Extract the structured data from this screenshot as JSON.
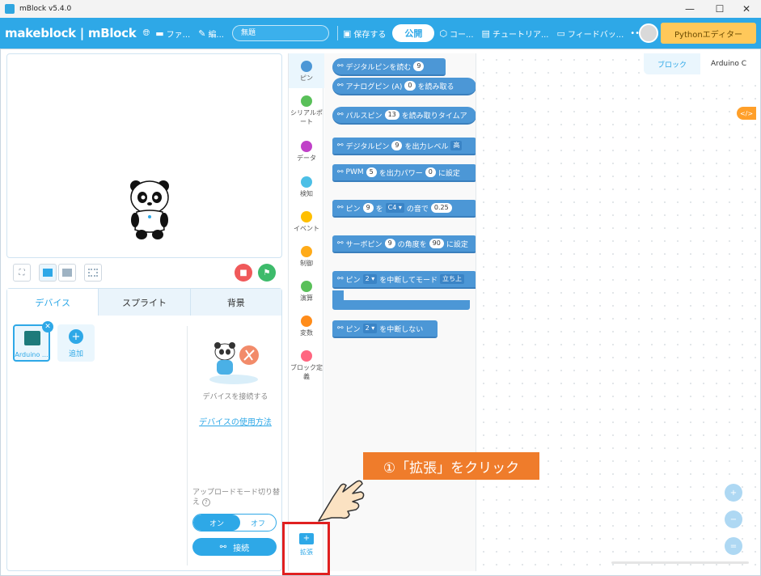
{
  "window": {
    "title": "mBlock v5.4.0",
    "minimize": "—",
    "maximize": "☐",
    "close": "✕"
  },
  "menubar": {
    "brand": "makeblock | mBlock",
    "file": "ファ...",
    "edit": "編...",
    "project_title": "無題",
    "save": "保存する",
    "publish": "公開",
    "course": "コー...",
    "tutorial": "チュートリア...",
    "feedback": "フィードバッ...",
    "more": "•••",
    "python_editor": "Pythonエディター",
    "icons": {
      "globe": "globe-icon",
      "folder": "folder-icon",
      "wrench": "wrench-icon",
      "save": "save-icon",
      "course": "course-icon",
      "tutorial": "book-icon",
      "feedback": "feedback-icon"
    }
  },
  "stage": {
    "sprite": "panda",
    "tools": {
      "fullscreen": "⛶",
      "stop": "■",
      "go": "⚑"
    }
  },
  "device_panel": {
    "tabs": [
      "デバイス",
      "スプライト",
      "背景"
    ],
    "active_tab": 0,
    "device_label": "Arduino ...",
    "add_label": "追加",
    "connect_prompt": "デバイスを接続する",
    "howto_link": "デバイスの使用方法",
    "upload_mode_label": "アップロードモード切り替え",
    "toggle_on": "オン",
    "toggle_off": "オフ",
    "connect_button": "接続"
  },
  "categories": [
    {
      "label": "ピン",
      "color": "#4c97d6"
    },
    {
      "label": "シリアルポート",
      "color": "#59c059"
    },
    {
      "label": "データ",
      "color": "#c040c8"
    },
    {
      "label": "検知",
      "color": "#4cbfe6"
    },
    {
      "label": "イベント",
      "color": "#ffbf00"
    },
    {
      "label": "制御",
      "color": "#ffab19"
    },
    {
      "label": "演算",
      "color": "#59c059"
    },
    {
      "label": "変数",
      "color": "#ff8c1a"
    },
    {
      "label": "ブロック定義",
      "color": "#ff6680"
    }
  ],
  "extension": {
    "label": "拡張",
    "icon": "+"
  },
  "blocks": {
    "b1": {
      "pre": "デジタルピンを読む",
      "v1": "9"
    },
    "b2": {
      "pre": "アナログピン (A)",
      "v1": "0",
      "post": "を読み取る"
    },
    "b3": {
      "pre": "パルスピン",
      "v1": "13",
      "post": "を読み取りタイムア"
    },
    "b4": {
      "pre": "デジタルピン",
      "v1": "9",
      "mid": "を出力レベル",
      "v2": "高"
    },
    "b5": {
      "pre": "PWM",
      "v1": "5",
      "mid": "を出力パワー",
      "v2": "0",
      "post": "に設定"
    },
    "b6": {
      "pre": "ピン",
      "v1": "9",
      "mid": "を",
      "d1": "C4 ▾",
      "mid2": "の音で",
      "v2": "0.25"
    },
    "b7": {
      "pre": "サーボピン",
      "v1": "9",
      "mid": "の角度を",
      "v2": "90",
      "post": "に設定"
    },
    "b8": {
      "pre": "ピン",
      "d1": "2 ▾",
      "mid": "を中断してモード",
      "v2": "立ち上"
    },
    "b9": {
      "pre": "ピン",
      "d1": "2 ▾",
      "post": "を中断しない"
    }
  },
  "workspace": {
    "tab_blocks": "ブロック",
    "tab_code": "Arduino C",
    "code_toggle": "</>",
    "zoom_in": "+",
    "zoom_out": "−",
    "zoom_reset": "="
  },
  "annotation": {
    "callout": "①「拡張」をクリック"
  }
}
